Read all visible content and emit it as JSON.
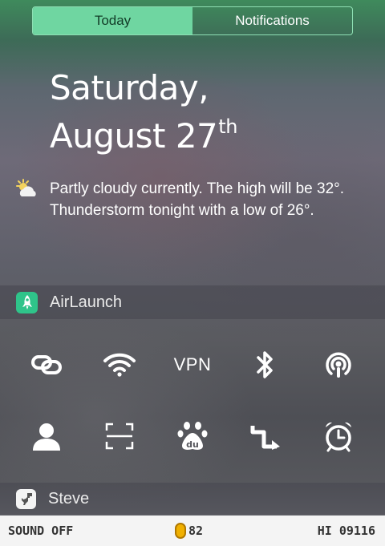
{
  "tabs": [
    {
      "label": "Today",
      "active": true
    },
    {
      "label": "Notifications",
      "active": false
    }
  ],
  "date": {
    "line1": "Saturday,",
    "line2": "August 27",
    "suffix": "th"
  },
  "weather": {
    "icon": "partly-cloudy-icon",
    "text": "Partly cloudy currently. The high will be 32°. Thunderstorm tonight with a low of 26°."
  },
  "airlaunch": {
    "title": "AirLaunch",
    "icon": "rocket-icon",
    "accent": "#2fc48a",
    "tiles_row1": [
      {
        "icon": "link-icon"
      },
      {
        "icon": "wifi-icon"
      },
      {
        "icon": "vpn-text",
        "label": "VPN"
      },
      {
        "icon": "bluetooth-icon"
      },
      {
        "icon": "podcast-icon"
      }
    ],
    "tiles_row2": [
      {
        "icon": "person-icon"
      },
      {
        "icon": "scan-icon"
      },
      {
        "icon": "baidu-paw-icon"
      },
      {
        "icon": "shortcut-arrow-icon"
      },
      {
        "icon": "alarm-clock-icon"
      }
    ]
  },
  "steve": {
    "title": "Steve",
    "icon": "dinosaur-icon"
  },
  "game": {
    "sound": "SOUND OFF",
    "coins": "82",
    "hi_score": "HI 09116"
  }
}
